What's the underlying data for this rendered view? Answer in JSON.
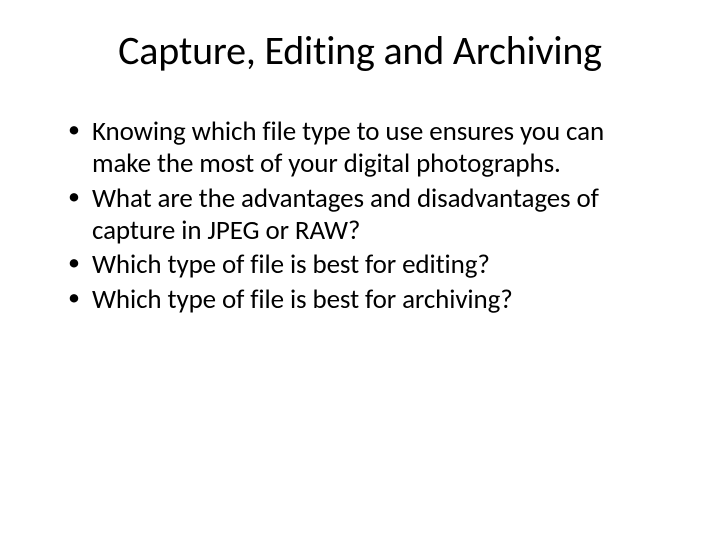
{
  "slide": {
    "title": "Capture, Editing and Archiving",
    "bullets": [
      "Knowing which file type to use ensures you can make the most of your digital photographs.",
      "What are the advantages and disadvantages of capture in JPEG or RAW?",
      "Which type of file is best for editing?",
      "Which type of file is best for archiving?"
    ]
  }
}
